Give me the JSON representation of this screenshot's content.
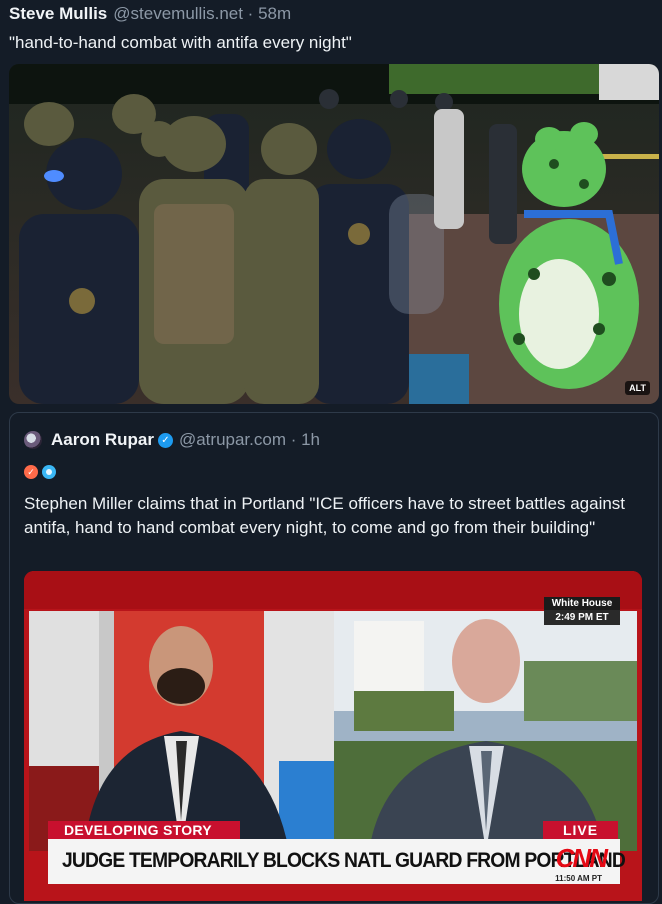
{
  "post": {
    "author_name": "Steve Mullis",
    "author_handle": "@stevemullis.net · 58m",
    "text": "\"hand-to-hand combat with antifa every night\"",
    "media_alt_badge": "ALT"
  },
  "quote": {
    "author_name": "Aaron Rupar",
    "author_handle": "@atrupar.com · 1h",
    "text": "Stephen Miller claims that in Portland \"ICE officers have to street battles against antifa, hand to hand combat every night, to come and go from their building\"",
    "video": {
      "location_label": "White House",
      "location_time": "2:49 PM ET",
      "tag": "DEVELOPING STORY",
      "live": "LIVE",
      "headline": "JUDGE TEMPORARILY BLOCKS NATL GUARD FROM PORTLAND",
      "network": "CNN",
      "network_time": "11:50 AM PT"
    }
  },
  "colors": {
    "background": "#141c27",
    "verified": "#1d9bf0",
    "cnn_red": "#c8102e"
  }
}
